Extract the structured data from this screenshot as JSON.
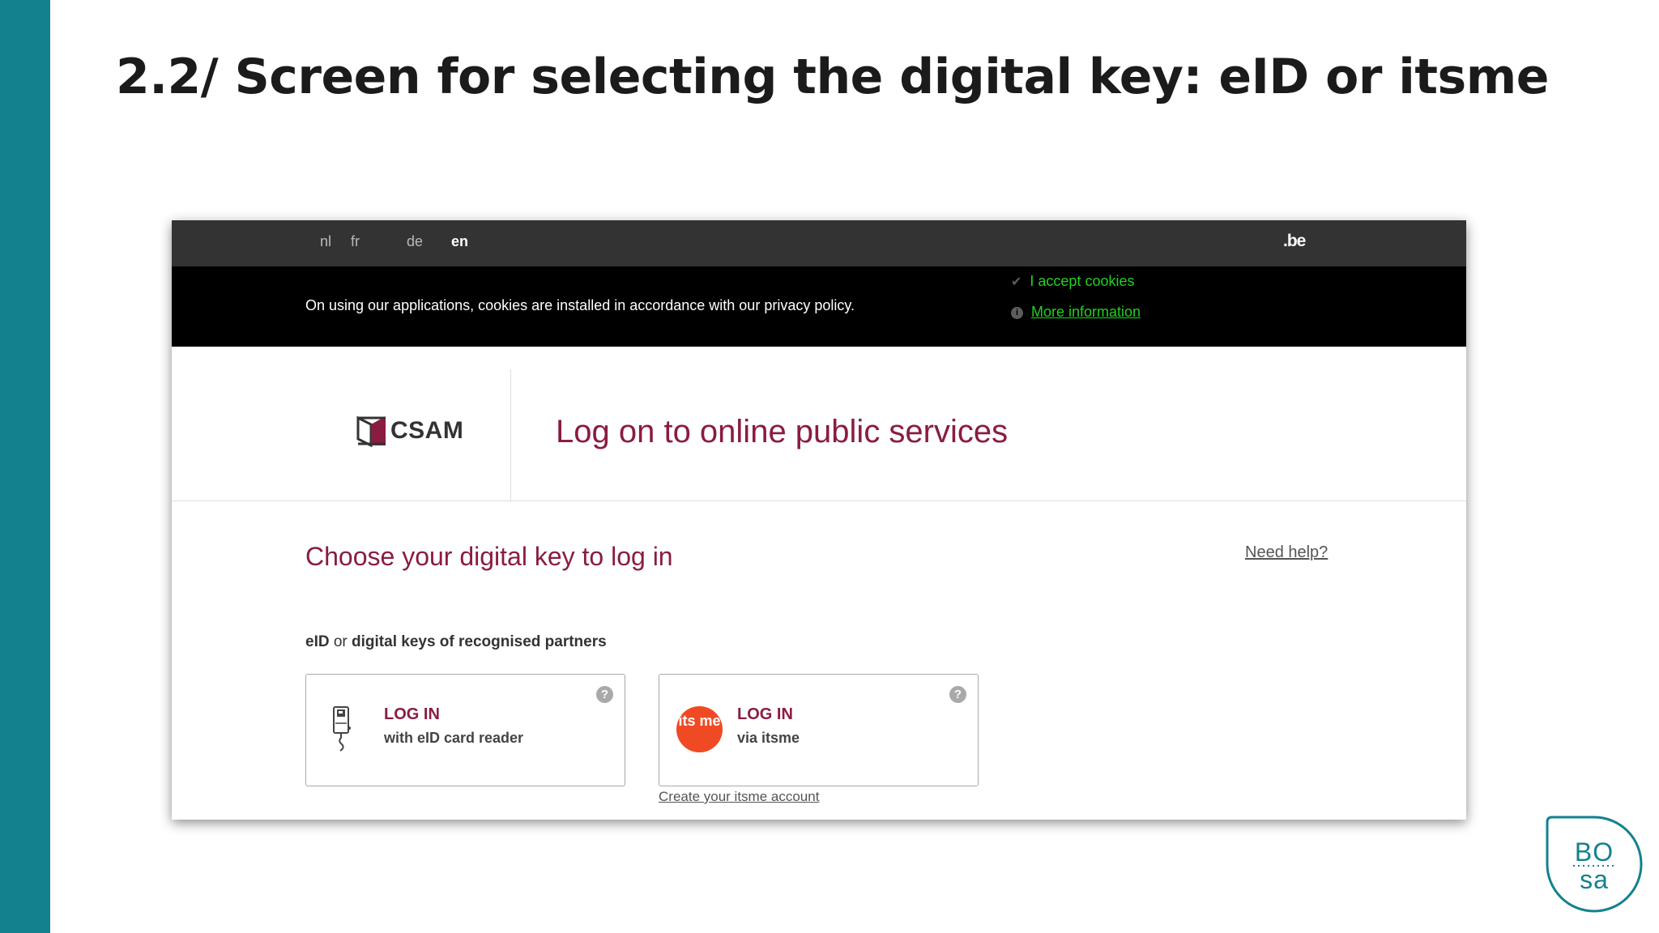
{
  "slide": {
    "title": "2.2/ Screen for selecting the digital key: eID or itsme"
  },
  "topbar": {
    "languages": [
      {
        "label": "nl",
        "active": false
      },
      {
        "label": "fr",
        "active": false
      },
      {
        "label": "de",
        "active": false
      },
      {
        "label": "en",
        "active": true
      }
    ],
    "be_logo": ".be"
  },
  "cookie_bar": {
    "message": "On using our applications, cookies are installed in accordance with our privacy policy.",
    "accept_label": "I accept cookies",
    "more_info_label": "More information",
    "accent_color": "#21d121"
  },
  "header": {
    "logo_text": "CSAM",
    "title": "Log on to online public services"
  },
  "main": {
    "choose_title": "Choose your digital key to log in",
    "need_help": "Need help?",
    "keys_label": {
      "part1": "eID",
      "part2": " or ",
      "part3": "digital keys of recognised partners"
    },
    "cards": [
      {
        "title": "LOG IN",
        "subtitle": "with eID card reader",
        "icon": "card-reader-icon",
        "help": "?"
      },
      {
        "title": "LOG IN",
        "subtitle": "via itsme",
        "icon": "itsme-logo-icon",
        "help": "?",
        "icon_text": "its me"
      }
    ],
    "create_itsme": "Create your itsme account"
  },
  "brand": {
    "accent": "#8a1c42",
    "sidebar_color": "#13818e",
    "bosa_logo": "BO sa"
  }
}
